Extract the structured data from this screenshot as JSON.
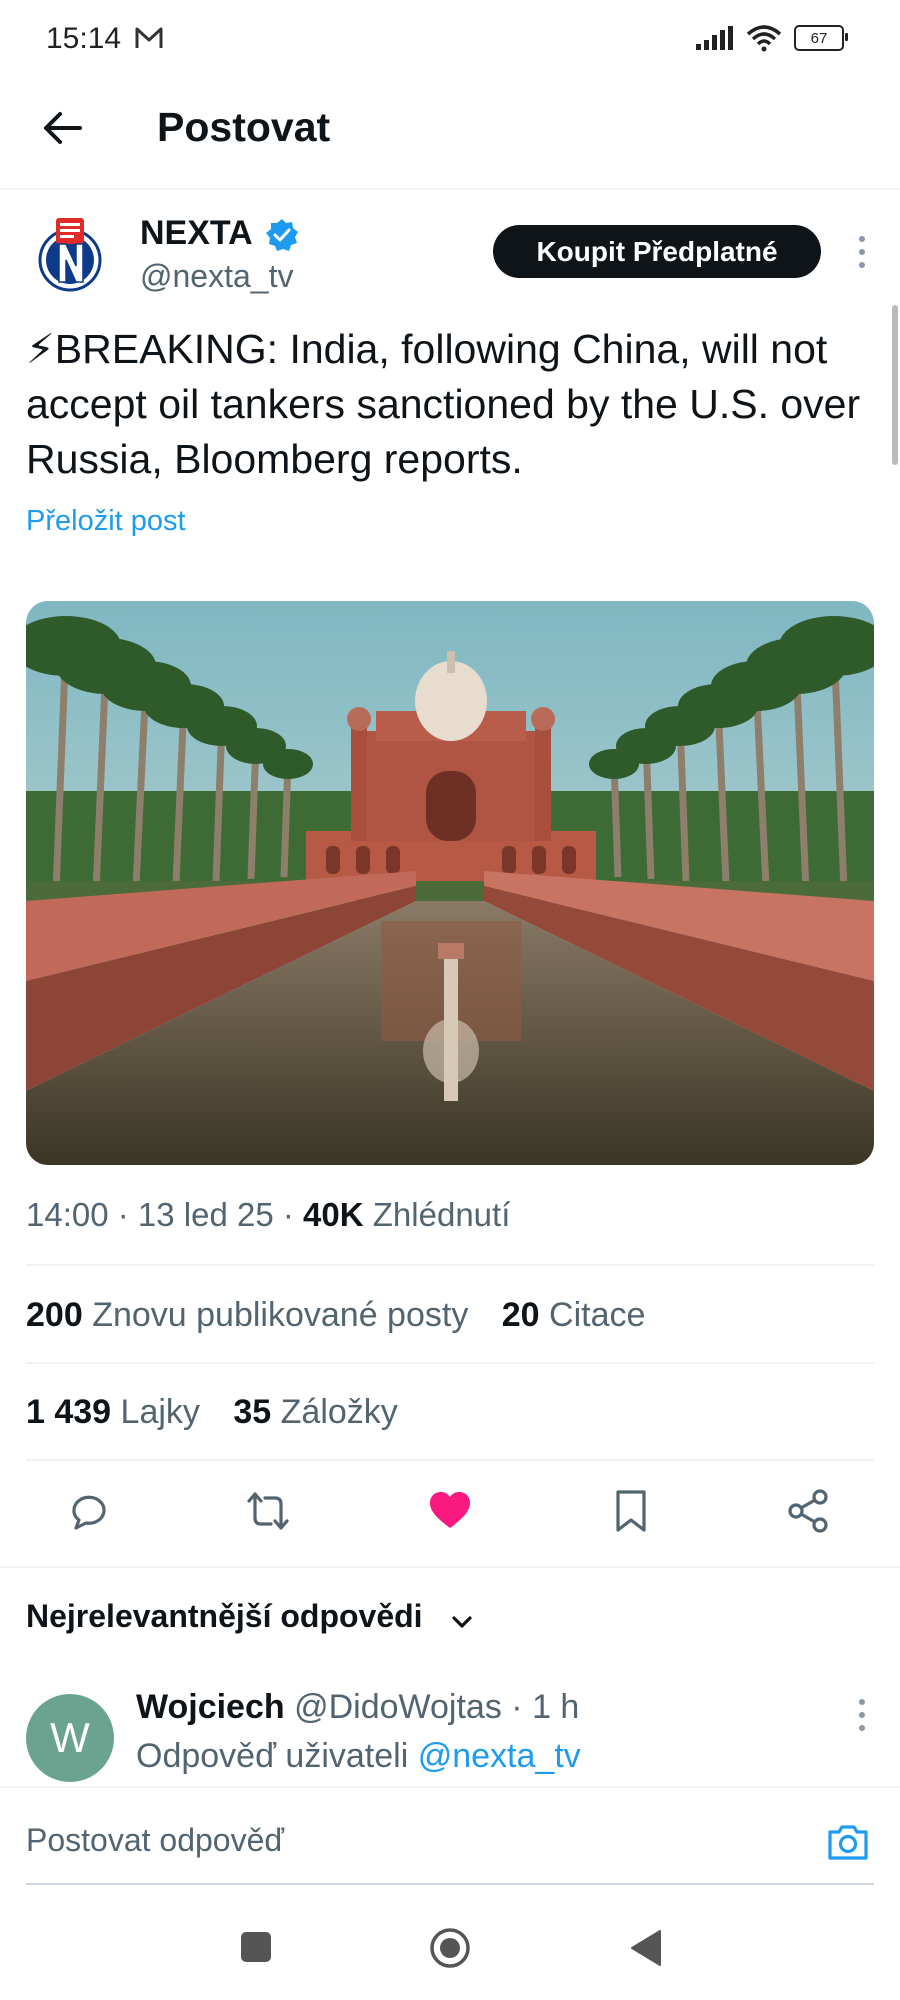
{
  "status_bar": {
    "time": "15:14",
    "battery": "67"
  },
  "header": {
    "title": "Postovat"
  },
  "post": {
    "author_name": "NEXTA",
    "handle": "@nexta_tv",
    "subscribe_label": "Koupit Předplatné",
    "text": "⚡BREAKING: India, following China, will not accept oil tankers sanctioned by the U.S. over Russia, Bloomberg reports.",
    "translate_label": "Přeložit post",
    "time": "14:00",
    "date": "13 led 25",
    "views_count": "40K",
    "views_label": "Zhlédnutí",
    "reposts_count": "200",
    "reposts_label": "Znovu publikované posty",
    "quotes_count": "20",
    "quotes_label": "Citace",
    "likes_count": "1 439",
    "likes_label": "Lajky",
    "bookmarks_count": "35",
    "bookmarks_label": "Záložky"
  },
  "replies": {
    "sort_label": "Nejrelevantnější odpovědi",
    "items": [
      {
        "avatar_letter": "W",
        "name": "Wojciech",
        "handle": "@DidoWojtas",
        "time": "1 h",
        "reply_to_prefix": "Odpověď uživateli",
        "reply_to_handle": "@nexta_tv"
      }
    ]
  },
  "compose": {
    "placeholder": "Postovat odpověď"
  },
  "colors": {
    "accent": "#1d9bf0",
    "like": "#f91880",
    "text": "#0f1419",
    "muted": "#536471"
  },
  "icons": [
    "mail-icon",
    "signal-icon",
    "wifi-icon",
    "battery-icon",
    "back-arrow-icon",
    "verified-badge-icon",
    "more-options-icon",
    "reply-icon",
    "repost-icon",
    "like-icon",
    "bookmark-icon",
    "share-icon",
    "chevron-down-icon",
    "camera-icon",
    "nav-recents-icon",
    "nav-home-icon",
    "nav-back-icon"
  ]
}
